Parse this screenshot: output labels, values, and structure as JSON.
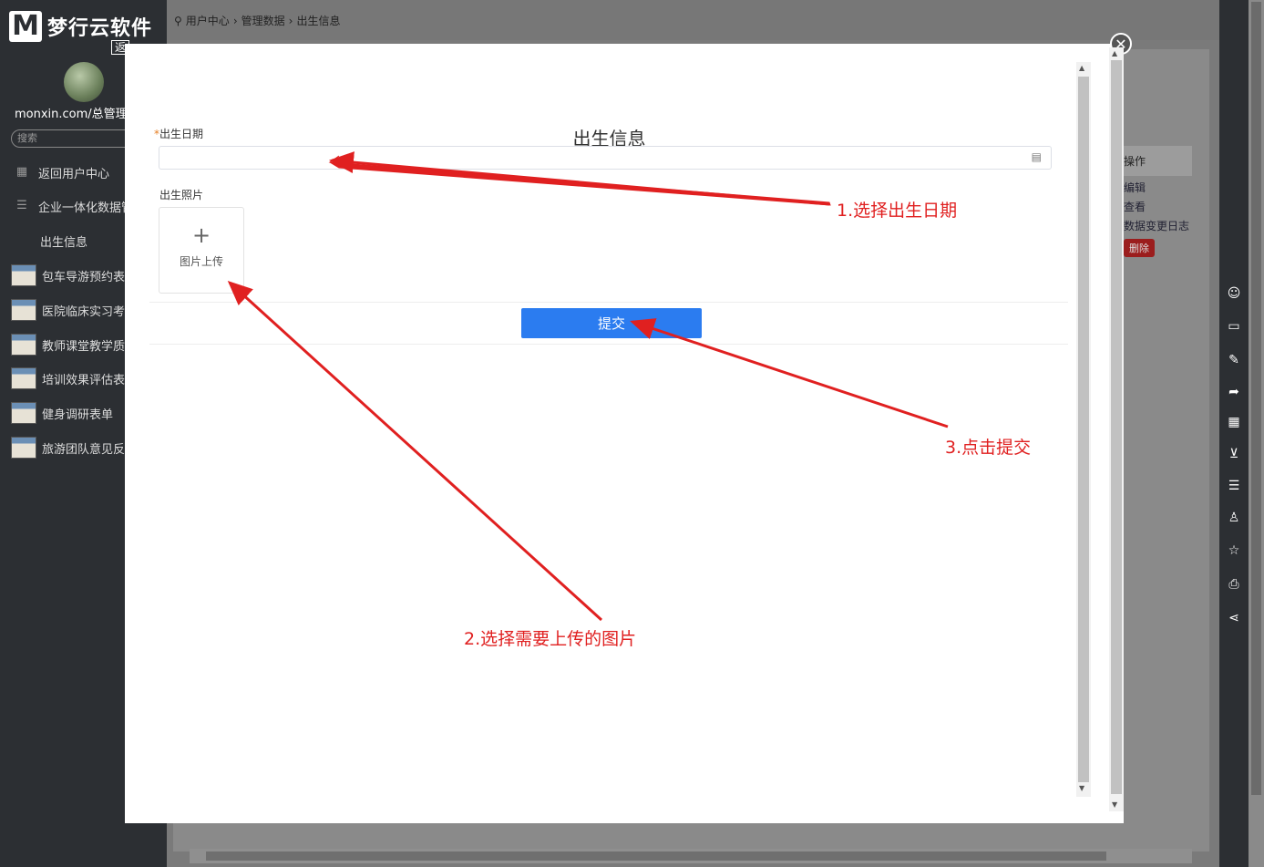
{
  "sidebar": {
    "logo_mark": "M",
    "logo_text": "梦行云软件",
    "logo_back": "返",
    "user_name": "monxin.com/总管理",
    "search_placeholder": "搜索",
    "items": [
      {
        "label": "返回用户中心",
        "icon": "grid-icon"
      },
      {
        "label": "企业一体化数据管",
        "icon": "list-icon"
      },
      {
        "label": "出生信息",
        "icon": ""
      },
      {
        "label": "包车导游预约表单",
        "icon": "thumbnail"
      },
      {
        "label": "医院临床实习考核",
        "icon": "thumbnail"
      },
      {
        "label": "教师课堂教学质量",
        "icon": "thumbnail"
      },
      {
        "label": "培训效果评估表单",
        "icon": "thumbnail"
      },
      {
        "label": "健身调研表单",
        "icon": "thumbnail"
      },
      {
        "label": "旅游团队意见反馈",
        "icon": "thumbnail"
      }
    ]
  },
  "breadcrumb": [
    "用户中心",
    "管理数据",
    "出生信息"
  ],
  "background_table": {
    "header": "操作",
    "links": [
      "编辑",
      "查看",
      "数据变更日志"
    ],
    "delete_label": "删除"
  },
  "modal": {
    "title": "出生信息",
    "date_field_label": "出生日期",
    "required_mark": "*",
    "photo_field_label": "出生照片",
    "upload_plus": "+",
    "upload_label": "图片上传",
    "submit_label": "提交",
    "close_symbol": "✕"
  },
  "annotations": {
    "step1": "1.选择出生日期",
    "step2": "2.选择需要上传的图片",
    "step3": "3.点击提交",
    "color": "#e02020"
  },
  "colors": {
    "sidebar_bg": "#2c2f33",
    "submit_bg": "#2b7cf0",
    "delete_bg": "#9b1d1d"
  }
}
